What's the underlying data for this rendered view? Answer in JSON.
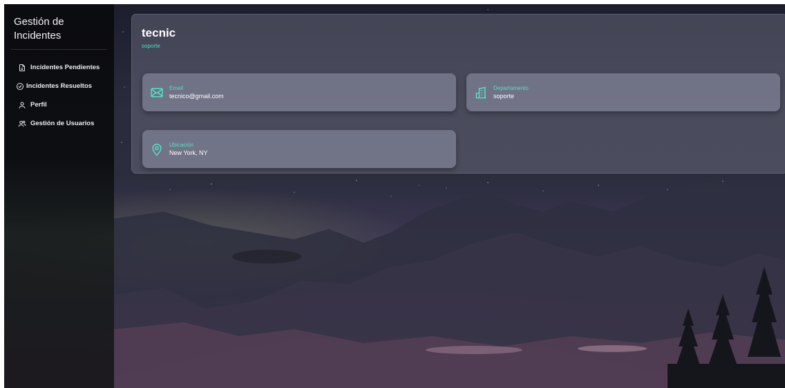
{
  "sidebar": {
    "title": "Gestión de Incidentes",
    "items": [
      {
        "label": "Incidentes Pendientes",
        "icon": "document-icon"
      },
      {
        "label": "Incidentes Resueltos",
        "icon": "check-circle-icon"
      },
      {
        "label": "Perfil",
        "icon": "user-icon"
      },
      {
        "label": "Gestión de Usuarios",
        "icon": "users-icon"
      }
    ]
  },
  "profile": {
    "name": "tecnic",
    "role": "soporte",
    "cards": {
      "email": {
        "label": "Email",
        "value": "tecnico@gmail.com",
        "icon": "mail-icon"
      },
      "department": {
        "label": "Departamento",
        "value": "soporte",
        "icon": "building-icon"
      },
      "location": {
        "label": "Ubicación",
        "value": "New York, NY",
        "icon": "map-pin-icon"
      }
    }
  },
  "colors": {
    "accent": "#48e0c0",
    "sidebar_bg": "#0b0c0f"
  }
}
